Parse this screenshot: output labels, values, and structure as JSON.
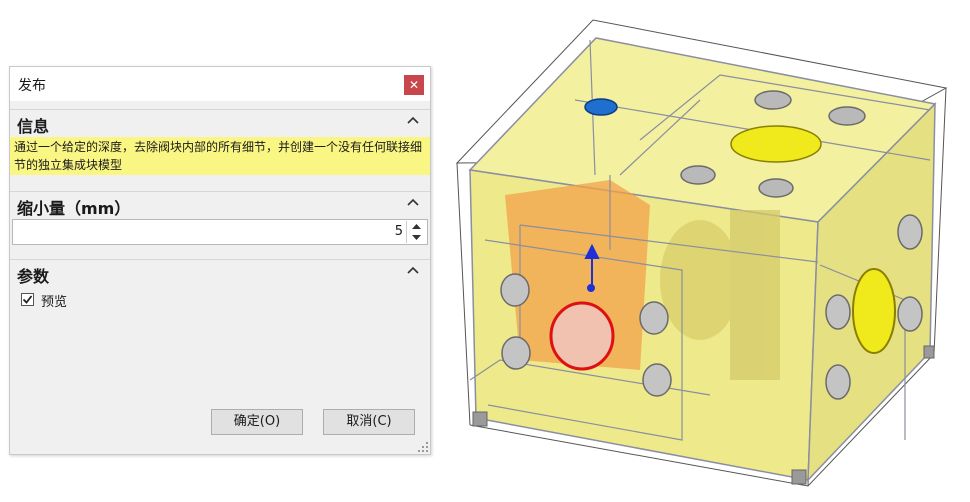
{
  "dialog": {
    "title": "发布",
    "close_glyph": "✕",
    "info": {
      "heading": "信息",
      "message": "通过一个给定的深度，去除阀块内部的所有细节，并创建一个没有任何联接细节的独立集成块模型"
    },
    "shrink": {
      "heading": "缩小量（mm）",
      "value": "5"
    },
    "params": {
      "heading": "参数",
      "preview_label": "预览",
      "preview_checked": true
    },
    "buttons": {
      "ok_label": "确定(O)",
      "cancel_label": "取消(C)"
    }
  },
  "model": {
    "colors": {
      "body_fill": "#f2ef9a",
      "edge": "#8a8ea0",
      "port_gray": "#a7a7a7",
      "port_yellow": "#f0ea1c",
      "port_red": "#dd1111",
      "port_blue": "#1f6fd1",
      "internal_orange": "#f3a24a",
      "triad_blue": "#1f2fd8"
    },
    "icons": [
      "close-icon",
      "collapse-up-icon",
      "spin-up-icon",
      "spin-down-icon",
      "check-icon",
      "resize-grip-icon"
    ]
  }
}
